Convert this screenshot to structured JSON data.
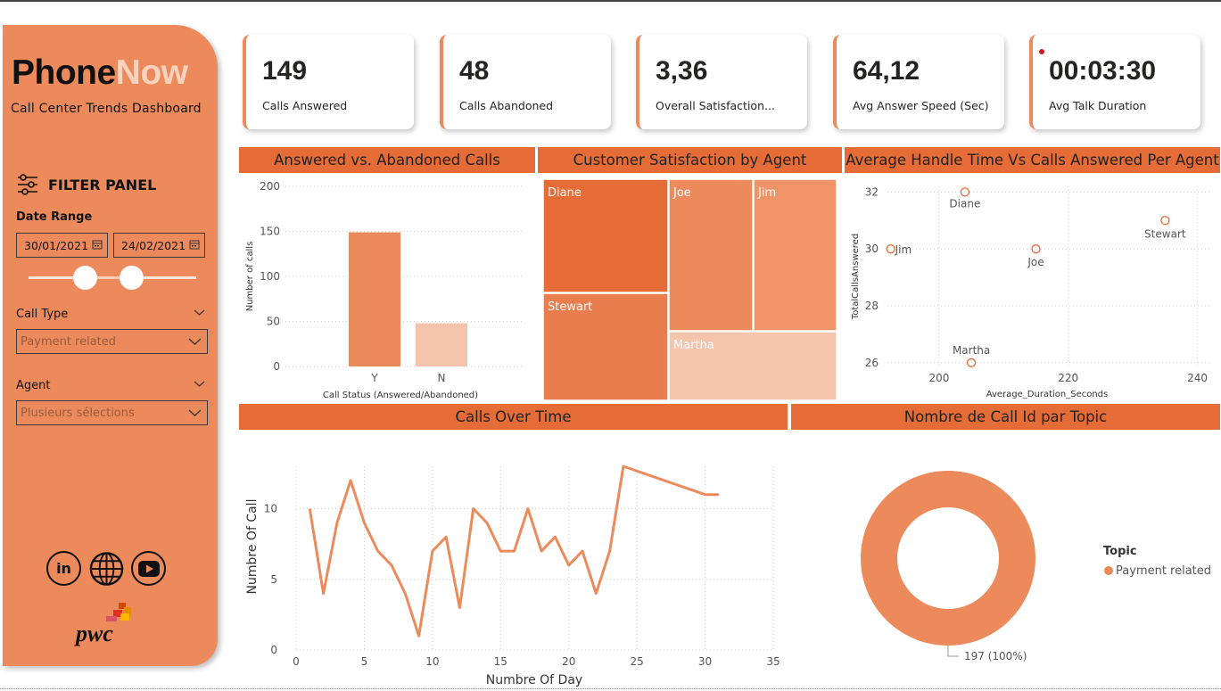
{
  "brand": {
    "part1": "Phone",
    "part2": "Now",
    "subtitle": "Call Center Trends Dashboard"
  },
  "colors": {
    "sidebar": "#ed8a5c",
    "accent": "#e66c37",
    "light": "#f2c3ad"
  },
  "filter": {
    "title": "FILTER PANEL",
    "icon": "sliders-icon",
    "date_range_label": "Date Range",
    "date_start": "30/01/2021",
    "date_end": "24/02/2021",
    "call_type_label": "Call Type",
    "call_type_value": "Payment related",
    "agent_label": "Agent",
    "agent_value": "Plusieurs sélections"
  },
  "social": {
    "icons": [
      "linkedin-icon",
      "globe-icon",
      "youtube-icon"
    ],
    "linkedin_text": "in"
  },
  "logo": {
    "text": "pwc"
  },
  "kpis": [
    {
      "value": "149",
      "label": "Calls Answered"
    },
    {
      "value": "48",
      "label": "Calls Abandoned"
    },
    {
      "value": "3,36",
      "label": "Overall Satisfaction..."
    },
    {
      "value": "64,12",
      "label": "Avg Answer Speed (Sec)"
    },
    {
      "value": "00:03:30",
      "label": "Avg Talk Duration"
    }
  ],
  "headers": {
    "answered": "Answered vs. Abandoned Calls",
    "satisfaction": "Customer Satisfaction by Agent",
    "handle": "Average Handle Time Vs Calls Answered Per Agent",
    "overtime": "Calls Over Time",
    "topic": "Nombre de Call Id par Topic"
  },
  "chart_data": [
    {
      "type": "bar",
      "categories": [
        "Y",
        "N"
      ],
      "values": [
        149,
        48
      ],
      "xlabel": "Call Status (Answered/Abandoned)",
      "ylabel": "Number of calls",
      "ylim": [
        0,
        200
      ],
      "yticks": [
        "0",
        "50",
        "100",
        "150",
        "200"
      ],
      "colors": [
        "#ed8a5c",
        "#f4c4ad"
      ],
      "grid": true
    },
    {
      "type": "treemap",
      "items": [
        {
          "name": "Diane",
          "color": "#e66c37"
        },
        {
          "name": "Stewart",
          "color": "#ea7d4e"
        },
        {
          "name": "Joe",
          "color": "#ed8a5c"
        },
        {
          "name": "Jim",
          "color": "#ef9468"
        },
        {
          "name": "Martha",
          "color": "#f4c4ad"
        }
      ]
    },
    {
      "type": "scatter",
      "xlabel": "Average_Duration_Seconds",
      "ylabel": "TotalCallsAnswered",
      "xlim": [
        192,
        242
      ],
      "ylim": [
        25.9,
        32.2
      ],
      "xticks": [
        "200",
        "220",
        "240"
      ],
      "yticks": [
        "26",
        "28",
        "30",
        "32"
      ],
      "points": [
        {
          "name": "Diane",
          "x": 204,
          "y": 32
        },
        {
          "name": "Jim",
          "x": 192.5,
          "y": 30
        },
        {
          "name": "Joe",
          "x": 215,
          "y": 30
        },
        {
          "name": "Stewart",
          "x": 235,
          "y": 31
        },
        {
          "name": "Martha",
          "x": 205,
          "y": 26
        }
      ]
    },
    {
      "type": "line",
      "xlabel": "Numbre Of Day",
      "ylabel": "Numbre Of Call",
      "xlim": [
        0,
        35
      ],
      "ylim": [
        0,
        13
      ],
      "xticks": [
        "0",
        "5",
        "10",
        "15",
        "20",
        "25",
        "30",
        "35"
      ],
      "yticks": [
        "0",
        "5",
        "10"
      ],
      "x": [
        1,
        2,
        3,
        4,
        5,
        6,
        7,
        8,
        9,
        10,
        11,
        12,
        13,
        14,
        15,
        16,
        17,
        18,
        19,
        20,
        21,
        22,
        23,
        24,
        30,
        31
      ],
      "y": [
        10,
        4,
        9,
        12,
        9,
        7,
        6,
        4,
        1,
        7,
        8,
        3,
        10,
        9,
        7,
        7,
        10,
        7,
        8,
        6,
        7,
        4,
        7,
        13,
        11,
        11
      ]
    },
    {
      "type": "pie",
      "donut": true,
      "legend_title": "Topic",
      "legend_position": "right",
      "slices": [
        {
          "name": "Payment related",
          "value": 197,
          "label": "197 (100%)"
        }
      ]
    }
  ]
}
